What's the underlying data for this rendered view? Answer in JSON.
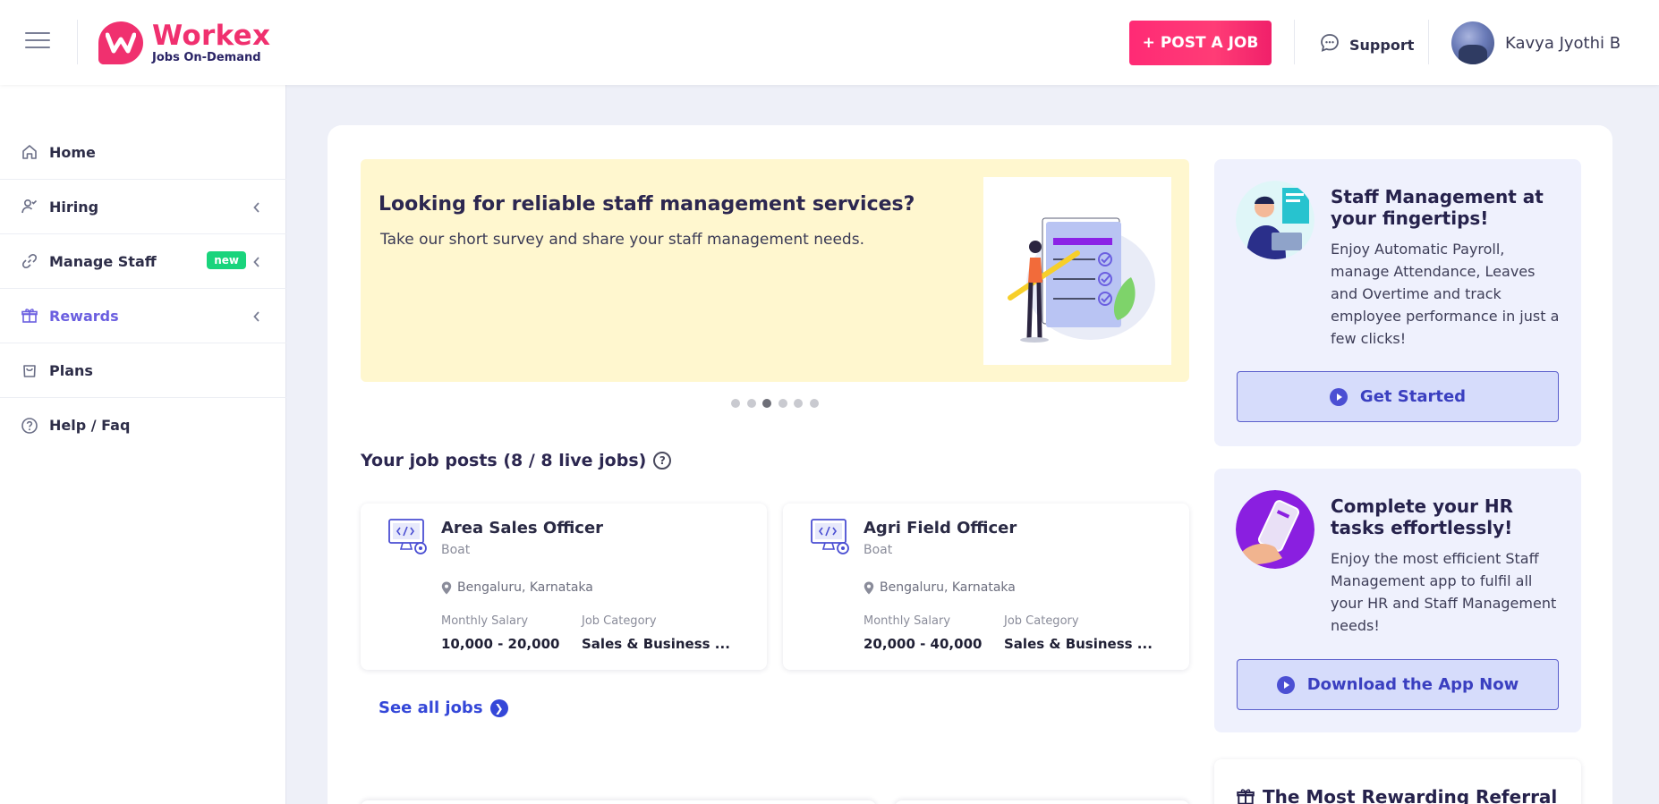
{
  "brand": {
    "title": "Workex",
    "tagline": "Jobs On-Demand",
    "color": "#f0306f"
  },
  "header": {
    "post_job_label": "+ POST A JOB",
    "support_label": "Support",
    "user_name": "Kavya Jyothi B"
  },
  "sidebar": {
    "items": [
      {
        "label": "Home",
        "icon": "home-icon"
      },
      {
        "label": "Hiring",
        "icon": "person-check-icon"
      },
      {
        "label": "Manage Staff",
        "icon": "link-icon",
        "badge": "new"
      },
      {
        "label": "Rewards",
        "icon": "gift-icon",
        "active": true
      },
      {
        "label": "Plans",
        "icon": "bag-icon"
      },
      {
        "label": "Help / Faq",
        "icon": "question-circle-icon"
      }
    ]
  },
  "banner": {
    "title": "Looking for reliable staff management services?",
    "subtitle": "Take our short survey and share your staff management needs.",
    "background": "#fff7cf",
    "slide_count": 6,
    "active_slide": 3
  },
  "jobs": {
    "heading": "Your job posts (8 / 8 live jobs)",
    "see_all_label": "See all jobs",
    "salary_label": "Monthly Salary",
    "category_label": "Job Category",
    "items": [
      {
        "title": "Area Sales Officer",
        "company": "Boat",
        "location": "Bengaluru, Karnataka",
        "salary": "10,000 - 20,000",
        "category": "Sales & Business ..."
      },
      {
        "title": "Agri Field Officer",
        "company": "Boat",
        "location": "Bengaluru, Karnataka",
        "salary": "20,000 - 40,000",
        "category": "Sales & Business ..."
      }
    ]
  },
  "promos": [
    {
      "title": "Staff Management at your fingertips!",
      "text": "Enjoy Automatic Payroll, manage Attendance, Leaves and Overtime and track employee performance in just a few clicks!",
      "button": "Get Started"
    },
    {
      "title": "Complete your HR tasks effortlessly!",
      "text": "Enjoy the most efficient Staff Management app to fulfil all your HR and Staff Management needs!",
      "button": "Download the App Now"
    }
  ],
  "referral": {
    "title": "The Most Rewarding Referral"
  }
}
